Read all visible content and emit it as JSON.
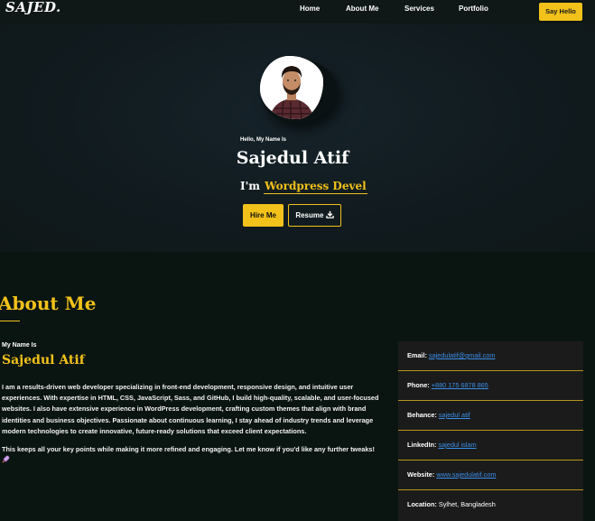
{
  "nav": {
    "logo": "SAJED.",
    "links": [
      "Home",
      "About Me",
      "Services",
      "Portfolio"
    ],
    "cta": "Say Hello"
  },
  "hero": {
    "greeting": "Hello, My Name Is",
    "name": "Sajedul Atif",
    "im_prefix": "I'm",
    "role": "Wordpress Devel",
    "hire_label": "Hire Me",
    "resume_label": "Resume",
    "resume_icon": "download-icon"
  },
  "about": {
    "title": "About Me",
    "my_name_is": "My Name Is",
    "name": "Sajedul Atif",
    "bio": "I am a results-driven web developer specializing in front-end development, responsive design, and intuitive user experiences. With expertise in HTML, CSS, JavaScript, Sass, and GitHub, I build high-quality, scalable, and user-focused websites. I also have extensive experience in WordPress development, crafting custom themes that align with brand identities and business objectives. Passionate about continuous learning, I stay ahead of industry trends and leverage modern technologies to create innovative, future-ready solutions that exceed client expectations.",
    "closing": "This keeps all your key points while making it more refined and engaging. Let me know if you'd like any further tweaks!",
    "closing_icon": "rocket-icon"
  },
  "info": {
    "email_label": "Email:",
    "email": "sajedulatif@gmail.com",
    "phone_label": "Phone:",
    "phone": "+880 175 6878 865",
    "behance_label": "Behance:",
    "behance": "sajedul atif",
    "linkedin_label": "LinkedIn:",
    "linkedin": "sajedul islam",
    "website_label": "Website:",
    "website": "www.sajedulatif.com",
    "location_label": "Location:",
    "location": "Sylhet, Bangladesh"
  },
  "colors": {
    "accent": "#f2c11a",
    "background": "#0a1512",
    "hero_bg": "#111b1f",
    "card_bg": "#1b1b1b",
    "link": "#3b8ee8"
  }
}
